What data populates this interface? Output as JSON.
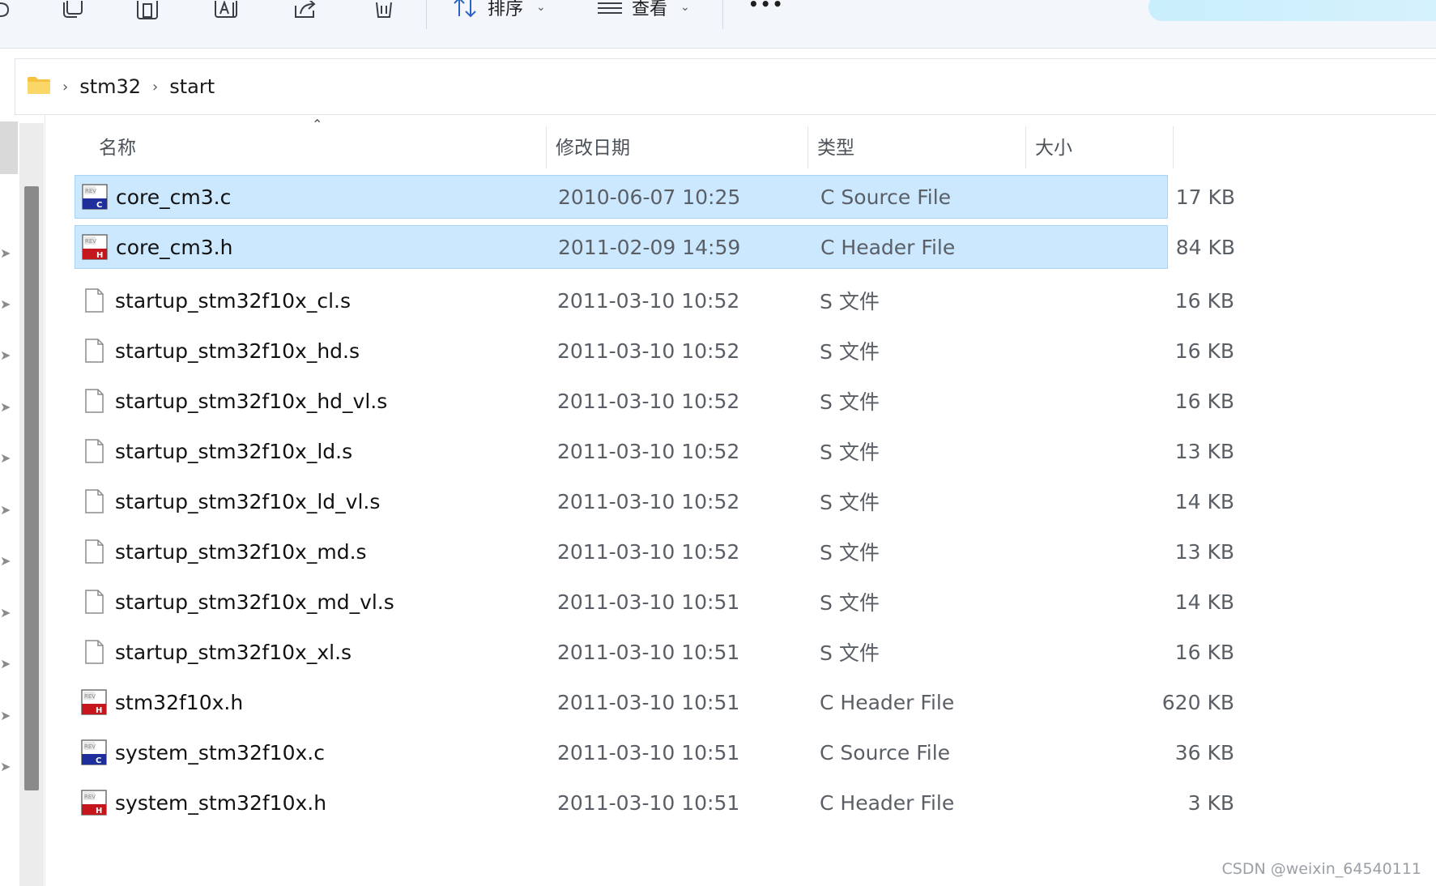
{
  "toolbar": {
    "sort_label": "排序",
    "view_label": "查看",
    "more_label": "•••"
  },
  "breadcrumb": {
    "items": [
      "stm32",
      "start"
    ]
  },
  "columns": {
    "name": "名称",
    "date": "修改日期",
    "type": "类型",
    "size": "大小"
  },
  "files": [
    {
      "name": "core_cm3.c",
      "date": "2010-06-07 10:25",
      "type": "C Source File",
      "size": "17 KB",
      "icon": "c-source-file-icon",
      "selected": true
    },
    {
      "name": "core_cm3.h",
      "date": "2011-02-09 14:59",
      "type": "C Header File",
      "size": "84 KB",
      "icon": "c-header-file-icon",
      "selected": true
    },
    {
      "name": "startup_stm32f10x_cl.s",
      "date": "2011-03-10 10:52",
      "type": "S 文件",
      "size": "16 KB",
      "icon": "generic-file-icon",
      "selected": false
    },
    {
      "name": "startup_stm32f10x_hd.s",
      "date": "2011-03-10 10:52",
      "type": "S 文件",
      "size": "16 KB",
      "icon": "generic-file-icon",
      "selected": false
    },
    {
      "name": "startup_stm32f10x_hd_vl.s",
      "date": "2011-03-10 10:52",
      "type": "S 文件",
      "size": "16 KB",
      "icon": "generic-file-icon",
      "selected": false
    },
    {
      "name": "startup_stm32f10x_ld.s",
      "date": "2011-03-10 10:52",
      "type": "S 文件",
      "size": "13 KB",
      "icon": "generic-file-icon",
      "selected": false
    },
    {
      "name": "startup_stm32f10x_ld_vl.s",
      "date": "2011-03-10 10:52",
      "type": "S 文件",
      "size": "14 KB",
      "icon": "generic-file-icon",
      "selected": false
    },
    {
      "name": "startup_stm32f10x_md.s",
      "date": "2011-03-10 10:52",
      "type": "S 文件",
      "size": "13 KB",
      "icon": "generic-file-icon",
      "selected": false
    },
    {
      "name": "startup_stm32f10x_md_vl.s",
      "date": "2011-03-10 10:51",
      "type": "S 文件",
      "size": "14 KB",
      "icon": "generic-file-icon",
      "selected": false
    },
    {
      "name": "startup_stm32f10x_xl.s",
      "date": "2011-03-10 10:51",
      "type": "S 文件",
      "size": "16 KB",
      "icon": "generic-file-icon",
      "selected": false
    },
    {
      "name": "stm32f10x.h",
      "date": "2011-03-10 10:51",
      "type": "C Header File",
      "size": "620 KB",
      "icon": "c-header-file-icon",
      "selected": false
    },
    {
      "name": "system_stm32f10x.c",
      "date": "2011-03-10 10:51",
      "type": "C Source File",
      "size": "36 KB",
      "icon": "c-source-file-icon",
      "selected": false
    },
    {
      "name": "system_stm32f10x.h",
      "date": "2011-03-10 10:51",
      "type": "C Header File",
      "size": "3 KB",
      "icon": "c-header-file-icon",
      "selected": false
    }
  ],
  "watermark": "CSDN @weixin_64540111",
  "colors": {
    "selection": "#cce8ff",
    "selection_border": "#a8d4f7",
    "source_icon": "#1e2f9c",
    "header_icon": "#c4161c",
    "folder": "#f5c242"
  }
}
